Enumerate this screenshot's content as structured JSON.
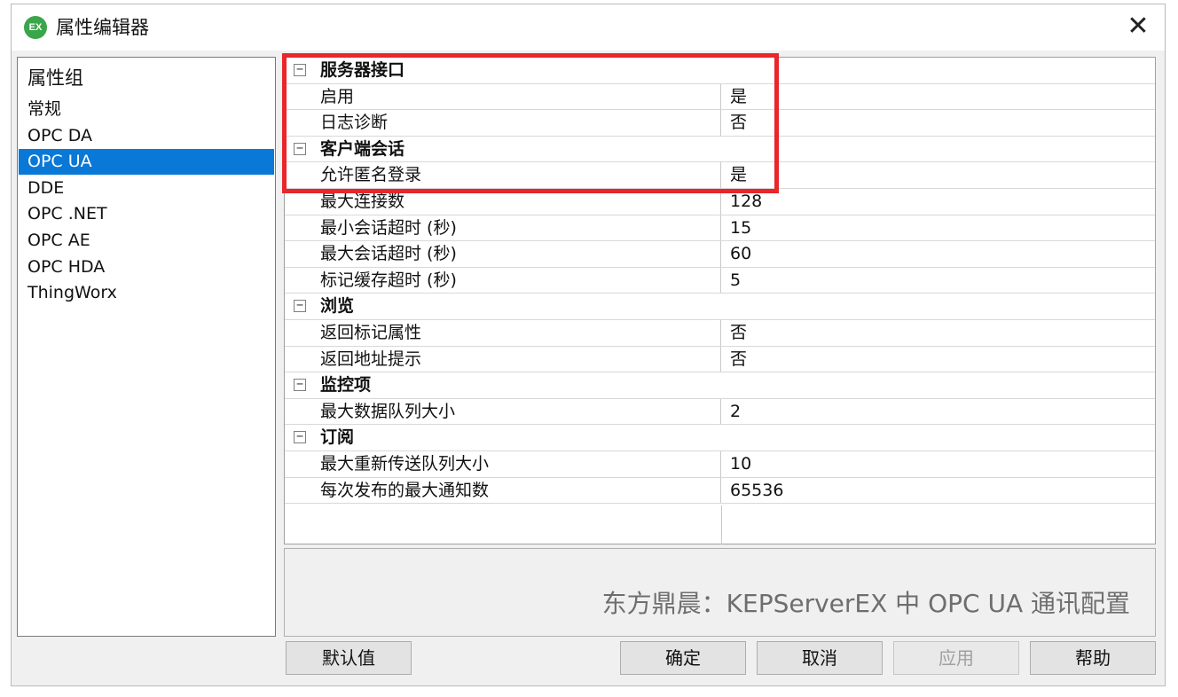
{
  "window": {
    "title": "属性编辑器",
    "icon_text": "EX",
    "close_glyph": "✕"
  },
  "left_panel": {
    "header": "属性组",
    "items": [
      {
        "label": "常规"
      },
      {
        "label": "OPC DA"
      },
      {
        "label": "OPC UA",
        "selected": true
      },
      {
        "label": "DDE"
      },
      {
        "label": "OPC .NET"
      },
      {
        "label": "OPC AE"
      },
      {
        "label": "OPC HDA"
      },
      {
        "label": "ThingWorx"
      }
    ]
  },
  "grid": {
    "expander_glyph": "−",
    "sections": [
      {
        "group": "服务器接口",
        "props": [
          {
            "name": "启用",
            "value": "是"
          },
          {
            "name": "日志诊断",
            "value": "否"
          }
        ]
      },
      {
        "group": "客户端会话",
        "props": [
          {
            "name": "允许匿名登录",
            "value": "是"
          },
          {
            "name": "最大连接数",
            "value": "128"
          },
          {
            "name": "最小会话超时 (秒)",
            "value": "15"
          },
          {
            "name": "最大会话超时 (秒)",
            "value": "60"
          },
          {
            "name": "标记缓存超时 (秒)",
            "value": "5"
          }
        ]
      },
      {
        "group": "浏览",
        "props": [
          {
            "name": "返回标记属性",
            "value": "否"
          },
          {
            "name": "返回地址提示",
            "value": "否"
          }
        ]
      },
      {
        "group": "监控项",
        "props": [
          {
            "name": "最大数据队列大小",
            "value": "2"
          }
        ]
      },
      {
        "group": "订阅",
        "props": [
          {
            "name": "最大重新传送队列大小",
            "value": "10"
          },
          {
            "name": "每次发布的最大通知数",
            "value": "65536"
          }
        ]
      }
    ]
  },
  "description": {
    "watermark": "东方鼎晨：KEPServerEX 中 OPC UA 通讯配置"
  },
  "buttons": {
    "defaults": "默认值",
    "ok": "确定",
    "cancel": "取消",
    "apply": "应用",
    "help": "帮助"
  },
  "colors": {
    "selection": "#0a78d6",
    "highlight_box": "#e8262b"
  }
}
